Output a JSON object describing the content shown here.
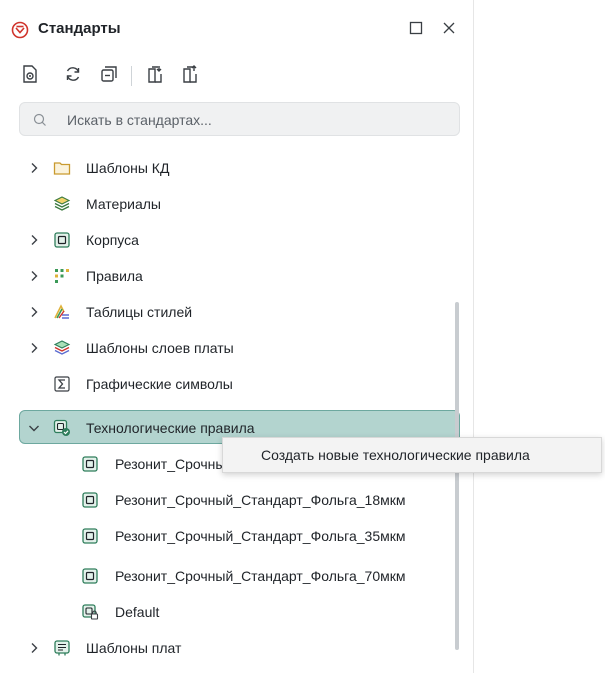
{
  "window": {
    "title": "Стандарты",
    "title_icon": "standards-logo-icon",
    "maximize_icon": "maximize-icon",
    "close_icon": "close-icon"
  },
  "toolbar": {
    "items": [
      {
        "name": "preview-document-icon"
      },
      {
        "name": "refresh-icon"
      },
      {
        "name": "collapse-all-icon"
      },
      {
        "name": "export-icon"
      },
      {
        "name": "import-icon"
      }
    ]
  },
  "search": {
    "placeholder": "Искать в стандартах...",
    "value": ""
  },
  "tree": {
    "items": [
      {
        "label": "Шаблоны КД",
        "icon": "folder-icon",
        "expandable": true,
        "expanded": false
      },
      {
        "label": "Материалы",
        "icon": "materials-stack-icon",
        "expandable": false
      },
      {
        "label": "Корпуса",
        "icon": "package-chip-icon",
        "expandable": true,
        "expanded": false
      },
      {
        "label": "Правила",
        "icon": "rules-grid-icon",
        "expandable": true,
        "expanded": false
      },
      {
        "label": "Таблицы стилей",
        "icon": "style-tables-icon",
        "expandable": true,
        "expanded": false
      },
      {
        "label": "Шаблоны слоев платы",
        "icon": "layer-stack-icon",
        "expandable": true,
        "expanded": false
      },
      {
        "label": "Графические символы",
        "icon": "sigma-symbol-icon",
        "expandable": false
      },
      {
        "label": "Технологические правила",
        "icon": "tech-rules-icon",
        "expandable": true,
        "expanded": true,
        "selected": true
      },
      {
        "label": "Резонит_Срочный",
        "icon": "chip-icon",
        "child": true
      },
      {
        "label": "Резонит_Срочный_Стандарт_Фольга_18мкм",
        "icon": "chip-icon",
        "child": true
      },
      {
        "label": "Резонит_Срочный_Стандарт_Фольга_35мкм",
        "icon": "chip-icon",
        "child": true
      },
      {
        "label": "Резонит_Срочный_Стандарт_Фольга_70мкм",
        "icon": "chip-icon",
        "child": true
      },
      {
        "label": "Default",
        "icon": "chip-lock-icon",
        "child": true
      },
      {
        "label": "Шаблоны плат",
        "icon": "board-template-icon",
        "expandable": true,
        "expanded": false
      }
    ]
  },
  "context_menu": {
    "items": [
      {
        "label": "Создать новые технологические правила"
      }
    ]
  },
  "colors": {
    "selected_bg": "#b3d4cf",
    "selected_border": "#6da89f",
    "accent_red": "#d0342c",
    "icon_green": "#2e7d5b"
  }
}
